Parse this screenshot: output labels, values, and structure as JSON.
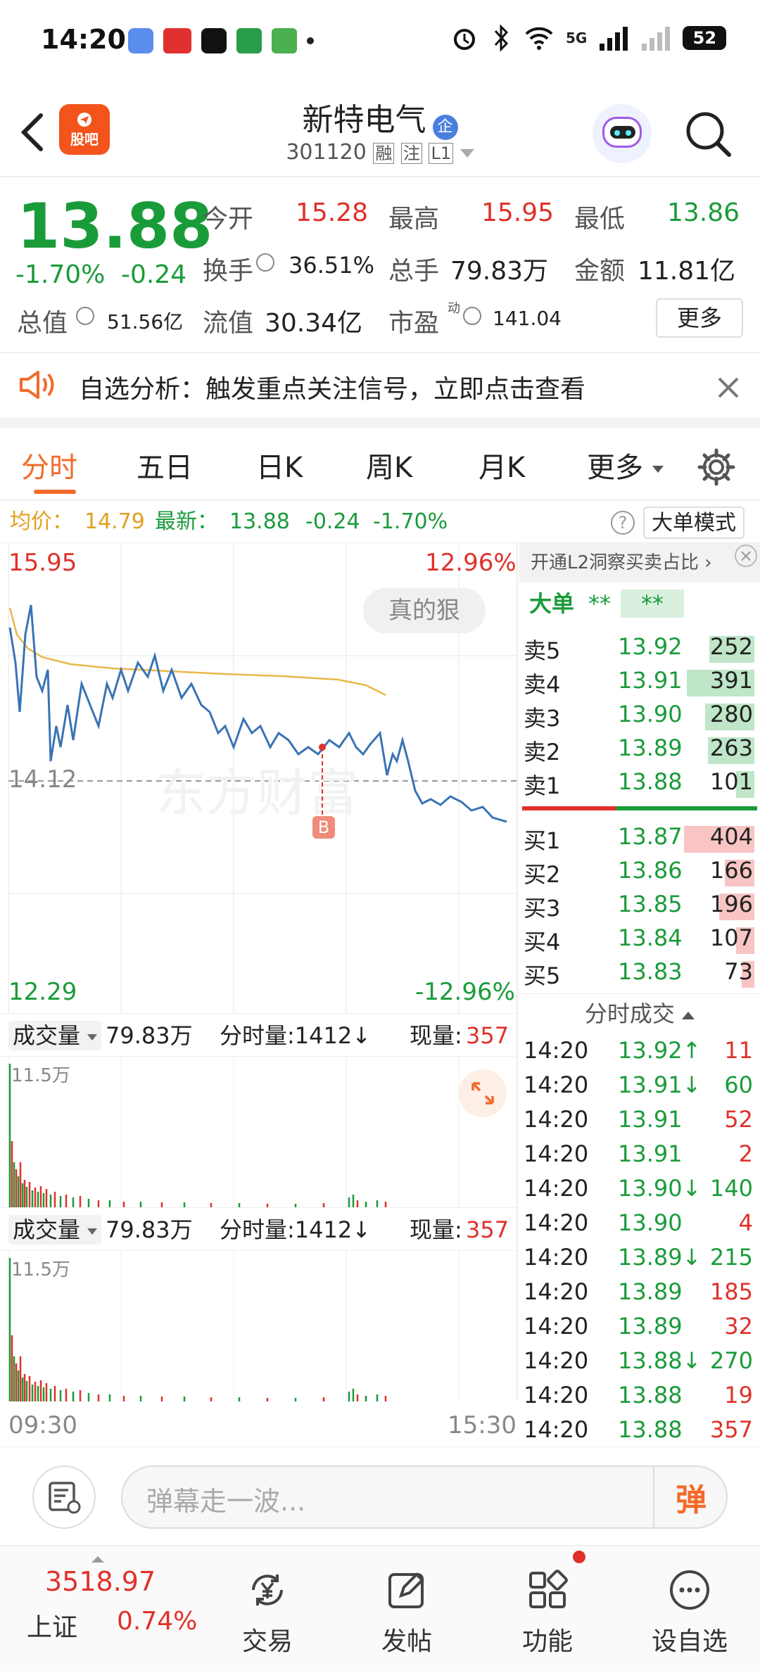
{
  "status_bar": {
    "time": "14:20",
    "network": "5G",
    "battery": "52"
  },
  "header": {
    "logo_text": "股吧",
    "stock_name": "新特电气",
    "enterprise_badge": "企",
    "stock_code": "301120",
    "tags": [
      "融",
      "注",
      "L1"
    ]
  },
  "quote": {
    "price": "13.88",
    "change_pct": "-1.70%",
    "change": "-0.24",
    "open_label": "今开",
    "open": "15.28",
    "high_label": "最高",
    "high": "15.95",
    "low_label": "最低",
    "low": "13.86",
    "turnover_label": "换手",
    "turnover": "36.51%",
    "volume_label": "总手",
    "volume": "79.83万",
    "amount_label": "金额",
    "amount": "11.81亿",
    "mktcap_label": "总值",
    "mktcap": "51.56亿",
    "float_label": "流值",
    "float": "30.34亿",
    "pe_label": "市盈",
    "pe_sup": "动",
    "pe": "141.04",
    "more_button": "更多"
  },
  "notice": {
    "text": "自选分析：触发重点关注信号，立即点击查看"
  },
  "tabs": [
    {
      "label": "分时",
      "active": true
    },
    {
      "label": "五日"
    },
    {
      "label": "日K"
    },
    {
      "label": "周K"
    },
    {
      "label": "月K"
    },
    {
      "label": "更多"
    }
  ],
  "info_line": {
    "avg_label": "均价：",
    "avg": "14.79",
    "latest_label": "最新：",
    "latest": "13.88",
    "chg": "-0.24",
    "pct": "-1.70%",
    "mode_button": "大单模式"
  },
  "chart": {
    "ymax": "15.95",
    "ymax_pct": "12.96%",
    "ymin": "12.29",
    "ymin_pct": "-12.96%",
    "prev_close": "14.12",
    "tag_bubble": "真的狠",
    "marker": "B",
    "watermark": "东方财富",
    "time_start": "09:30",
    "time_end": "15:30"
  },
  "volume_panel": {
    "dropdown": "成交量",
    "total": "79.83万",
    "tick_label": "分时量:1412↓",
    "now_label": "现量:",
    "now": "357",
    "max_label": "11.5万"
  },
  "orderbook": {
    "promo": "开通L2洞察买卖占比",
    "big_label": "大单",
    "big_value": "**",
    "big_value2": "**",
    "sells": [
      {
        "label": "卖5",
        "price": "13.92",
        "vol": "252"
      },
      {
        "label": "卖4",
        "price": "13.91",
        "vol": "391"
      },
      {
        "label": "卖3",
        "price": "13.90",
        "vol": "280"
      },
      {
        "label": "卖2",
        "price": "13.89",
        "vol": "263"
      },
      {
        "label": "卖1",
        "price": "13.88",
        "vol": "101"
      }
    ],
    "buys": [
      {
        "label": "买1",
        "price": "13.87",
        "vol": "404"
      },
      {
        "label": "买2",
        "price": "13.86",
        "vol": "166"
      },
      {
        "label": "买3",
        "price": "13.85",
        "vol": "196"
      },
      {
        "label": "买4",
        "price": "13.84",
        "vol": "107"
      },
      {
        "label": "买5",
        "price": "13.83",
        "vol": "73"
      }
    ],
    "ticks_title": "分时成交",
    "ticks": [
      {
        "time": "14:20",
        "price": "13.92↑",
        "vol": "11"
      },
      {
        "time": "14:20",
        "price": "13.91↓",
        "vol": "60"
      },
      {
        "time": "14:20",
        "price": "13.91",
        "vol": "52"
      },
      {
        "time": "14:20",
        "price": "13.91",
        "vol": "2"
      },
      {
        "time": "14:20",
        "price": "13.90↓",
        "vol": "140"
      },
      {
        "time": "14:20",
        "price": "13.90",
        "vol": "4"
      },
      {
        "time": "14:20",
        "price": "13.89↓",
        "vol": "215"
      },
      {
        "time": "14:20",
        "price": "13.89",
        "vol": "185"
      },
      {
        "time": "14:20",
        "price": "13.89",
        "vol": "32"
      },
      {
        "time": "14:20",
        "price": "13.88↓",
        "vol": "270"
      },
      {
        "time": "14:20",
        "price": "13.88",
        "vol": "19"
      },
      {
        "time": "14:20",
        "price": "13.88",
        "vol": "357"
      }
    ]
  },
  "comment_bar": {
    "placeholder": "弹幕走一波...",
    "danmu_button": "弹"
  },
  "bottom_nav": {
    "index_value": "3518.97",
    "index_name": "上证",
    "index_pct": "0.74%",
    "items": [
      {
        "label": "交易"
      },
      {
        "label": "发帖"
      },
      {
        "label": "功能"
      },
      {
        "label": "设自选"
      }
    ]
  }
}
